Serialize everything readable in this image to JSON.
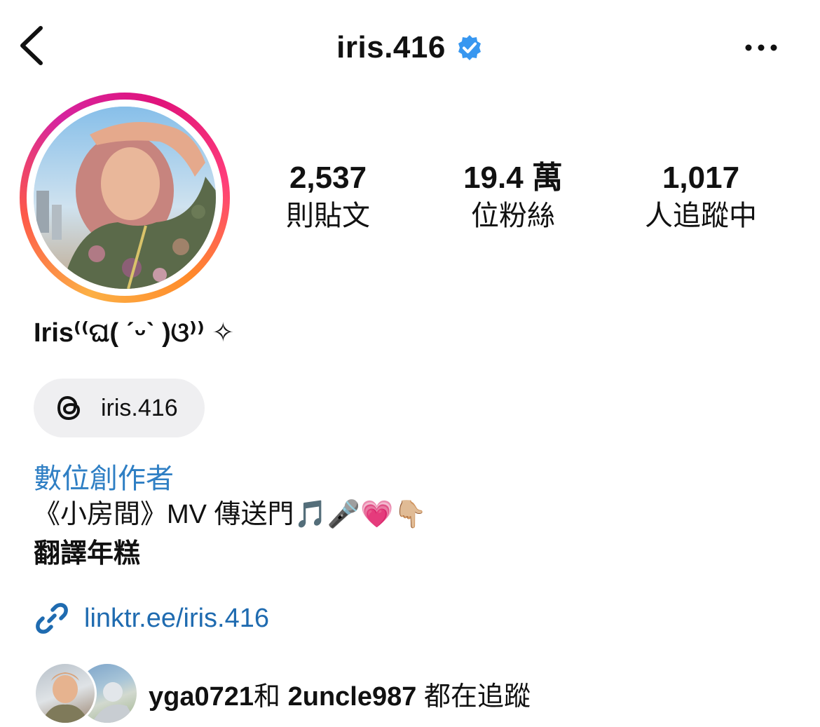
{
  "header": {
    "username": "iris.416",
    "verified_color": "#3897f0",
    "back_icon": "chevron-left-icon",
    "more_icon": "more-horizontal-icon"
  },
  "avatar": {
    "ring_colors": [
      "#fcb045",
      "#fd5949",
      "#d6249f"
    ]
  },
  "stats": [
    {
      "value": "2,537",
      "label": "則貼文"
    },
    {
      "value": "19.4 萬",
      "label": "位粉絲"
    },
    {
      "value": "1,017",
      "label": "人追蹤中"
    }
  ],
  "profile": {
    "display_name": "Iris⁽⁽ଘ( ˊᵕˋ )ଓ⁾⁾ ✧",
    "threads_handle": "iris.416",
    "threads_icon": "threads-icon",
    "category": "數位創作者",
    "bio_line1": "《小房間》MV 傳送門🎵🎤💗👇🏼",
    "bio_line2": "翻譯年糕",
    "link_text": "linktr.ee/iris.416",
    "link_icon": "link-icon",
    "link_color": "#1f6bb0",
    "category_color": "#2f7fc4"
  },
  "followed_by": {
    "user1": "yga0721",
    "connector": "和",
    "user2": "2uncle987",
    "suffix": "都在追蹤"
  }
}
